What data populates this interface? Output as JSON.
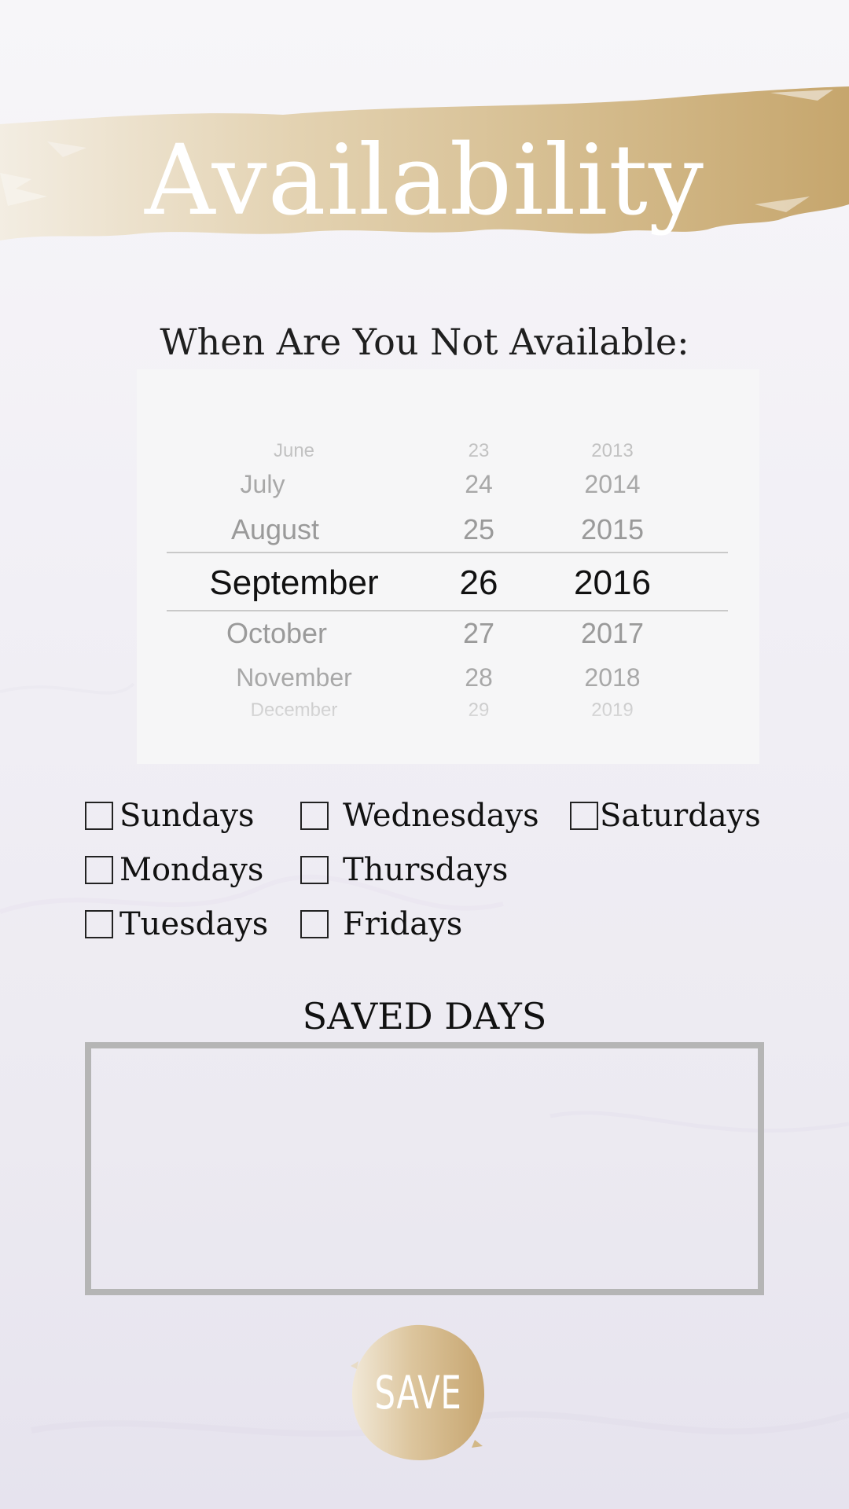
{
  "header": {
    "title": "Availability"
  },
  "form": {
    "prompt": "When Are You Not Available:"
  },
  "date_picker": {
    "months": [
      "June",
      "July",
      "August",
      "September",
      "October",
      "November",
      "December"
    ],
    "days": [
      "23",
      "24",
      "25",
      "26",
      "27",
      "28",
      "29"
    ],
    "years": [
      "2013",
      "2014",
      "2015",
      "2016",
      "2017",
      "2018",
      "2019"
    ],
    "selected_month": "September",
    "selected_day": "26",
    "selected_year": "2016"
  },
  "days": {
    "sundays": "Sundays",
    "mondays": "Mondays",
    "tuesdays": "Tuesdays",
    "wednesdays": "Wednesdays",
    "thursdays": "Thursdays",
    "fridays": "Fridays",
    "saturdays": "Saturdays"
  },
  "saved": {
    "title": "SAVED DAYS"
  },
  "actions": {
    "save_label": "SAVE"
  },
  "colors": {
    "gold_light": "#efe6d6",
    "gold": "#d9c39c",
    "gold_dark": "#c7a872",
    "box_border": "#b5b5b5"
  }
}
